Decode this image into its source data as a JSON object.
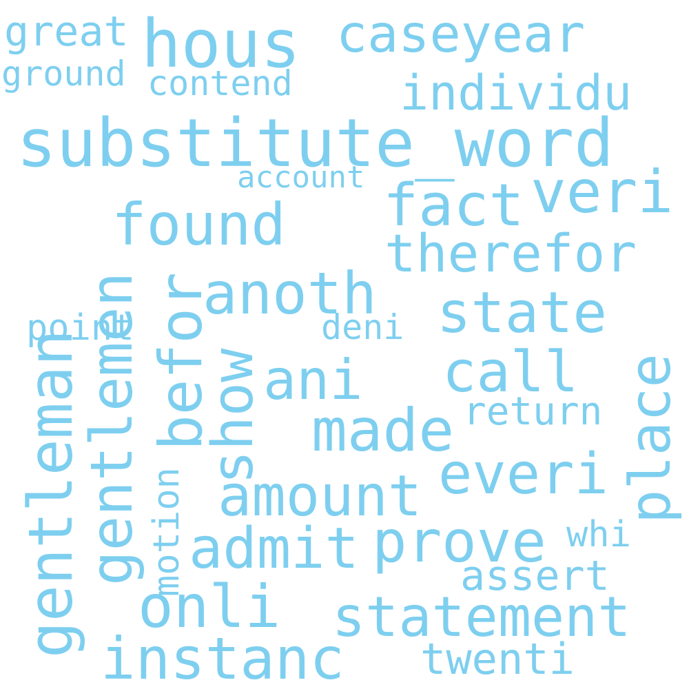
{
  "words": {
    "substitute_word": "substitute_word",
    "hous": "hous",
    "caseyear": "caseyear",
    "great": "great",
    "ground": "ground",
    "contend": "contend",
    "individu": "individu",
    "fact": "fact",
    "veri": "veri",
    "account": "account",
    "found": "found",
    "therefor": "therefor",
    "point": "point",
    "gentleman": "gentleman",
    "gentlemen": "gentlemen",
    "befor": "befor",
    "anoth": "anoth",
    "state": "state",
    "show": "show",
    "deni": "deni",
    "ani": "ani",
    "call": "call",
    "place": "place",
    "made": "made",
    "return": "return",
    "everi": "everi",
    "amount": "amount",
    "motion": "motion",
    "admit": "admit",
    "prove": "prove",
    "whi": "whi",
    "assert": "assert",
    "onli": "onli",
    "statement": "statement",
    "instanc": "instanc",
    "twenti": "twenti"
  },
  "colors": {
    "word": "#7ecfef",
    "background": "#ffffff"
  }
}
